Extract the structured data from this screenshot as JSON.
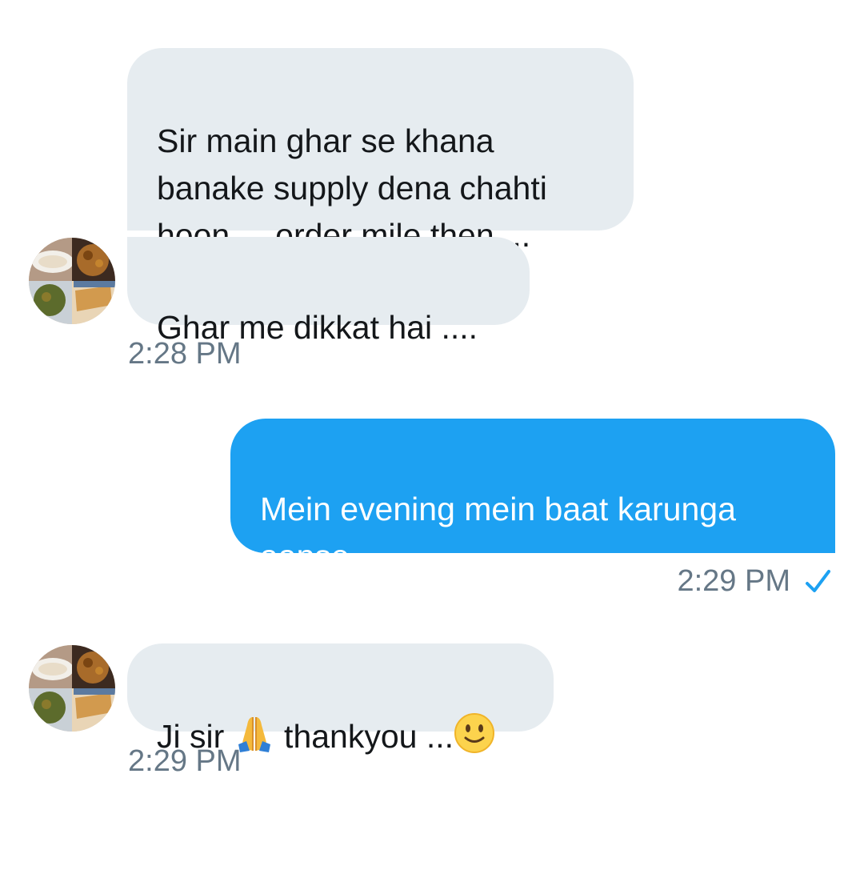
{
  "conversation": {
    "messages": [
      {
        "direction": "received",
        "text": "Sir main ghar se khana\nbanake supply dena chahti\nhoon ....order  mile then...."
      },
      {
        "direction": "received",
        "text": "Ghar me dikkat hai ...."
      },
      {
        "direction": "sent",
        "text": "Mein evening mein baat karunga\naapse"
      },
      {
        "direction": "received",
        "text_before": "Ji sir ",
        "text_middle": " thankyou ...",
        "emojis": [
          "folded-hands-icon",
          "smiling-face-icon"
        ]
      }
    ],
    "timestamps": {
      "first_group": "2:28 PM",
      "sent_group": "2:29 PM",
      "last_group": "2:29 PM"
    },
    "sent_status_icon": "checkmark-icon"
  },
  "colors": {
    "received_bubble": "#e6ecf0",
    "sent_bubble": "#1da1f2",
    "timestamp_text": "#657786",
    "check": "#1da1f2"
  }
}
